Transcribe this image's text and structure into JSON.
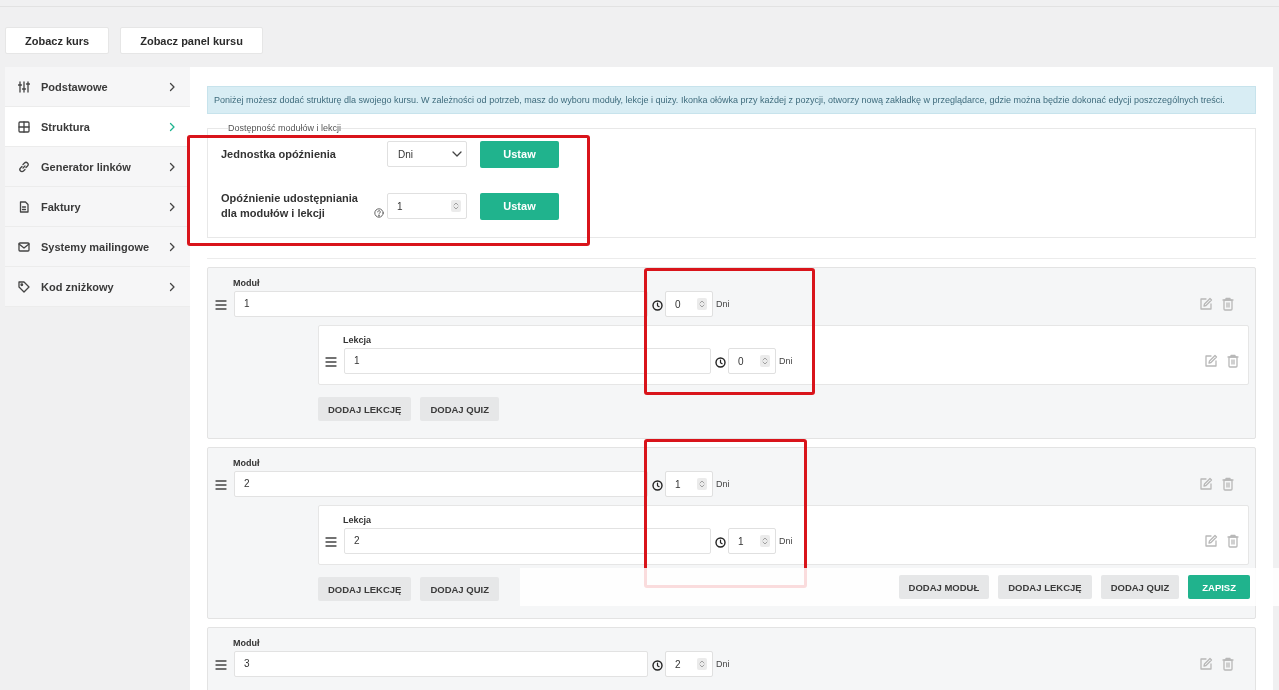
{
  "top_buttons": [
    "Zobacz kurs",
    "Zobacz panel kursu"
  ],
  "sidebar": {
    "items": [
      {
        "label": "Podstawowe",
        "kind": "sliders",
        "selected": false
      },
      {
        "label": "Struktura",
        "kind": "grid",
        "selected": true
      },
      {
        "label": "Generator linków",
        "kind": "link",
        "selected": false
      },
      {
        "label": "Faktury",
        "kind": "file",
        "selected": false
      },
      {
        "label": "Systemy mailingowe",
        "kind": "mail",
        "selected": false
      },
      {
        "label": "Kod zniżkowy",
        "kind": "tag",
        "selected": false
      }
    ]
  },
  "info_text": "Poniżej możesz dodać strukturę dla swojego kursu. W zależności od potrzeb, masz do wyboru moduły, lekcje i quizy. Ikonka ołówka przy każdej z pozycji, otworzy nową zakładkę w przeglądarce, gdzie można będzie dokonać edycji poszczególnych treści.",
  "availability": {
    "legend": "Dostępność modułów i lekcji",
    "highlighted": true,
    "rows": [
      {
        "label": "Jednostka opóźnienia",
        "kind": "select",
        "value": "Dni",
        "button": "Ustaw",
        "help": false
      },
      {
        "label": "Opóźnienie udostępniania dla modułów i lekcji",
        "kind": "number",
        "value": "1",
        "button": "Ustaw",
        "help": true
      }
    ]
  },
  "modules": [
    {
      "label": "Moduł",
      "value": "1",
      "delay": "0",
      "unit": "Dni",
      "highlighted": true,
      "lessons": [
        {
          "label": "Lekcja",
          "value": "1",
          "delay": "0",
          "unit": "Dni"
        }
      ],
      "buttons": [
        "DODAJ LEKCJĘ",
        "DODAJ QUIZ"
      ]
    },
    {
      "label": "Moduł",
      "value": "2",
      "delay": "1",
      "unit": "Dni",
      "highlighted": true,
      "lessons": [
        {
          "label": "Lekcja",
          "value": "2",
          "delay": "1",
          "unit": "Dni"
        }
      ],
      "buttons": [
        "DODAJ LEKCJĘ",
        "DODAJ QUIZ"
      ]
    },
    {
      "label": "Moduł",
      "value": "3",
      "delay": "2",
      "unit": "Dni",
      "highlighted": false
    }
  ],
  "action_bar": {
    "buttons": [
      {
        "label": "DODAJ MODUŁ",
        "kind": "secondary"
      },
      {
        "label": "DODAJ LEKCJĘ",
        "kind": "secondary"
      },
      {
        "label": "DODAJ QUIZ",
        "kind": "secondary"
      },
      {
        "label": "ZAPISZ",
        "kind": "primary"
      }
    ]
  }
}
